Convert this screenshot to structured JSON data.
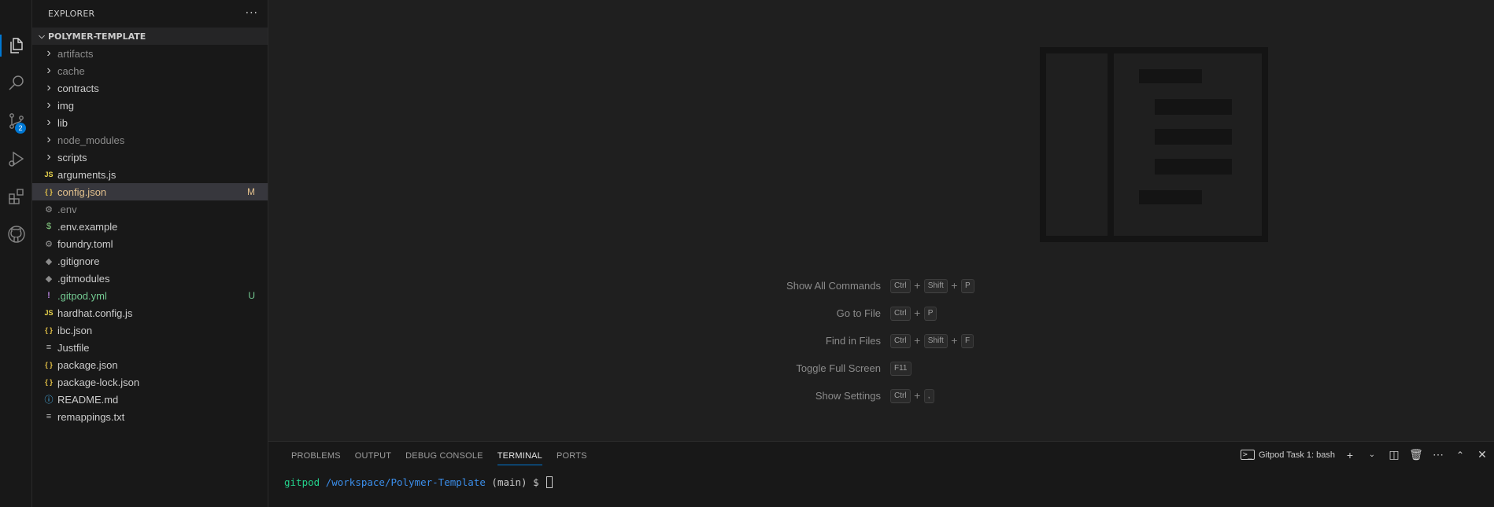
{
  "activity_bar": {
    "items": [
      "files-icon",
      "search-icon",
      "source-control-icon",
      "run-debug-icon",
      "extensions-icon",
      "github-icon"
    ],
    "source_control_badge": "2"
  },
  "sidebar": {
    "title": "EXPLORER",
    "more_label": "···",
    "project": "POLYMER-TEMPLATE",
    "items": [
      {
        "label": "artifacts",
        "icon": "chevron",
        "dim": true
      },
      {
        "label": "cache",
        "icon": "chevron",
        "dim": true
      },
      {
        "label": "contracts",
        "icon": "chevron"
      },
      {
        "label": "img",
        "icon": "chevron"
      },
      {
        "label": "lib",
        "icon": "chevron"
      },
      {
        "label": "node_modules",
        "icon": "chevron",
        "dim": true
      },
      {
        "label": "scripts",
        "icon": "chevron"
      },
      {
        "label": "arguments.js",
        "icon": "js"
      },
      {
        "label": "config.json",
        "icon": "json",
        "git": "M",
        "selected": true
      },
      {
        "label": ".env",
        "icon": "gear",
        "dim": true
      },
      {
        "label": ".env.example",
        "icon": "dollar"
      },
      {
        "label": "foundry.toml",
        "icon": "gear"
      },
      {
        "label": ".gitignore",
        "icon": "git"
      },
      {
        "label": ".gitmodules",
        "icon": "git"
      },
      {
        "label": ".gitpod.yml",
        "icon": "bang",
        "git": "U"
      },
      {
        "label": "hardhat.config.js",
        "icon": "js"
      },
      {
        "label": "ibc.json",
        "icon": "json"
      },
      {
        "label": "Justfile",
        "icon": "lines"
      },
      {
        "label": "package.json",
        "icon": "json"
      },
      {
        "label": "package-lock.json",
        "icon": "json"
      },
      {
        "label": "README.md",
        "icon": "info"
      },
      {
        "label": "remappings.txt",
        "icon": "lines"
      }
    ]
  },
  "editor": {
    "shortcuts": [
      {
        "label": "Show All Commands",
        "keys": [
          "Ctrl",
          "Shift",
          "P"
        ]
      },
      {
        "label": "Go to File",
        "keys": [
          "Ctrl",
          "P"
        ]
      },
      {
        "label": "Find in Files",
        "keys": [
          "Ctrl",
          "Shift",
          "F"
        ]
      },
      {
        "label": "Toggle Full Screen",
        "keys": [
          "F11"
        ]
      },
      {
        "label": "Show Settings",
        "keys": [
          "Ctrl",
          ","
        ]
      }
    ]
  },
  "panel": {
    "tabs": [
      "PROBLEMS",
      "OUTPUT",
      "DEBUG CONSOLE",
      "TERMINAL",
      "PORTS"
    ],
    "active_tab": "TERMINAL",
    "terminal_name": "Gitpod Task 1: bash",
    "prompt_user": "gitpod",
    "prompt_path": "/workspace/Polymer-Template",
    "prompt_branch": "(main)",
    "prompt_symbol": "$"
  },
  "colors": {
    "accent": "#0078d4",
    "modified": "#e2c08d",
    "untracked": "#73c991"
  }
}
